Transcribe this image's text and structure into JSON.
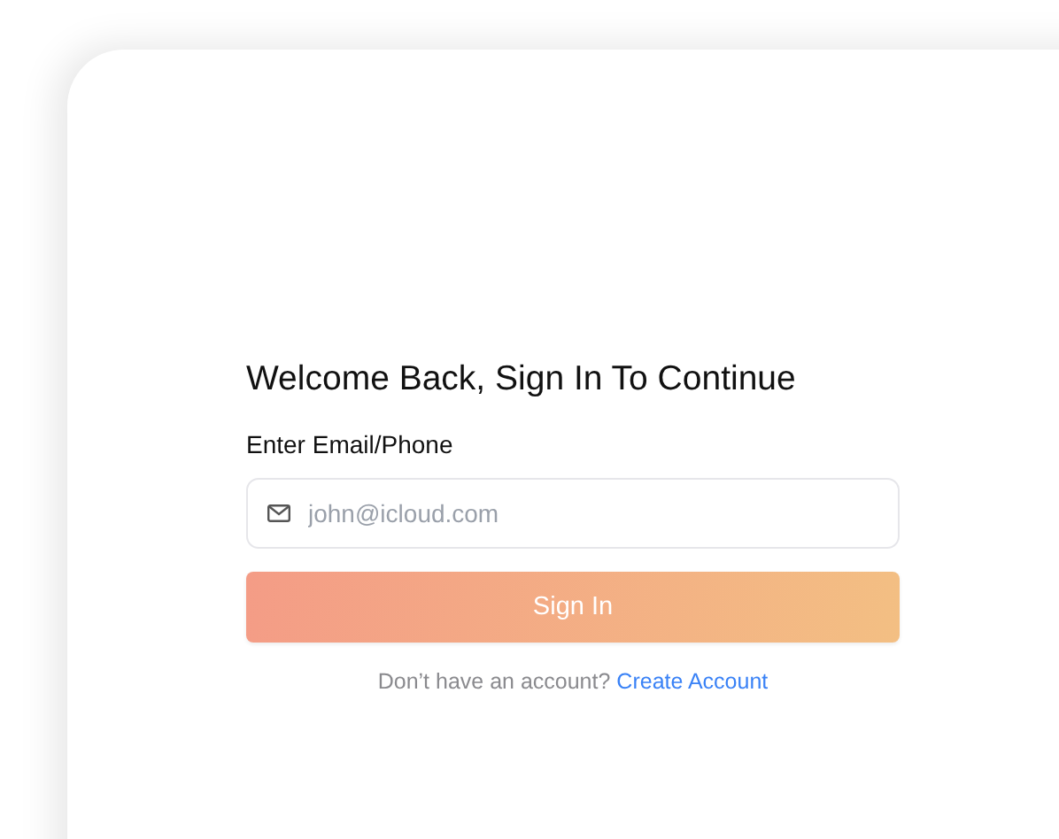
{
  "heading": "Welcome Back, Sign In To Continue",
  "email_field": {
    "label": "Enter Email/Phone",
    "placeholder": "john@icloud.com"
  },
  "sign_in_button": {
    "label": "Sign In"
  },
  "footer": {
    "text": "Don’t have an account?",
    "link": "Create Account"
  }
}
